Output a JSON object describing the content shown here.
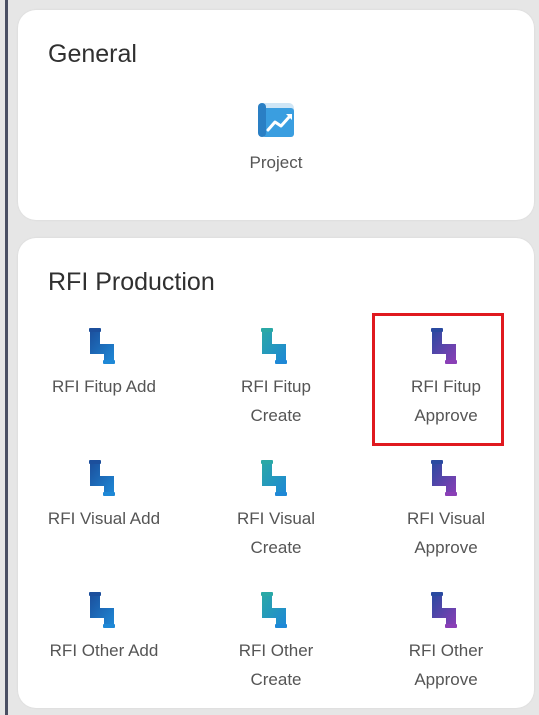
{
  "general": {
    "title": "General",
    "items": [
      {
        "label": "Project",
        "icon": "project-chart-icon"
      }
    ]
  },
  "rfi_production": {
    "title": "RFI Production",
    "items": [
      {
        "label": "RFI Fitup Add",
        "icon": "pipe-icon"
      },
      {
        "label": "RFI Fitup\nCreate",
        "icon": "pipe-icon"
      },
      {
        "label": "RFI Fitup\nApprove",
        "icon": "pipe-icon"
      },
      {
        "label": "RFI Visual Add",
        "icon": "pipe-icon"
      },
      {
        "label": "RFI Visual\nCreate",
        "icon": "pipe-icon"
      },
      {
        "label": "RFI Visual\nApprove",
        "icon": "pipe-icon"
      },
      {
        "label": "RFI Other Add",
        "icon": "pipe-icon"
      },
      {
        "label": "RFI Other\nCreate",
        "icon": "pipe-icon"
      },
      {
        "label": "RFI Other\nApprove",
        "icon": "pipe-icon"
      }
    ]
  },
  "colors": {
    "highlight": "#e0191f",
    "add_pipe": [
      "#1c4f9c",
      "#1e88d6"
    ],
    "create_pipe": [
      "#2aa8a6",
      "#1e88d6"
    ],
    "approve_pipe": [
      "#2a4aa0",
      "#8a3fb6"
    ]
  }
}
